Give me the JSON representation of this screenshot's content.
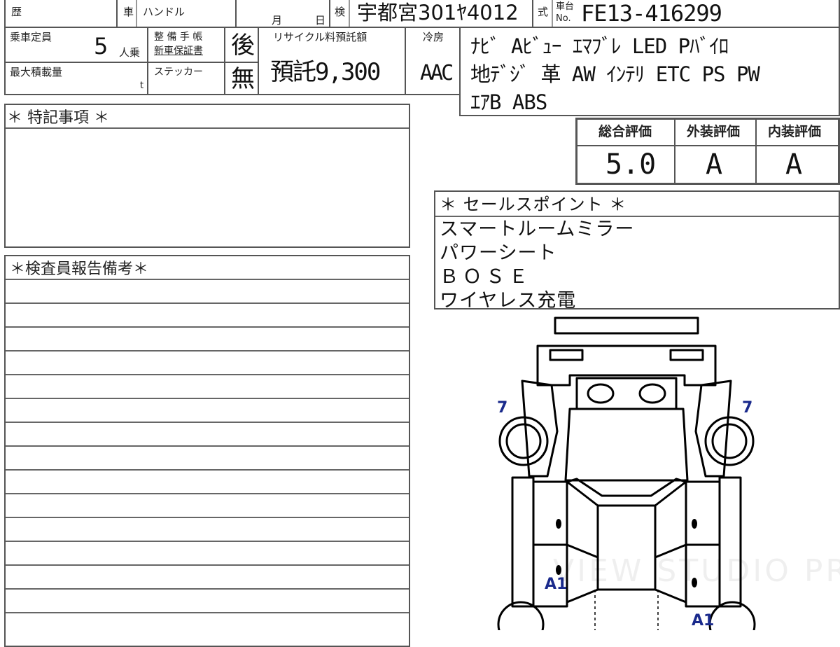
{
  "header": {
    "history_label": "歴",
    "car_label": "車",
    "handle_label": "ハンドル",
    "month_label": "月",
    "day_label": "日",
    "inspection_label": "検",
    "plate_value": "宇都宮301ﾔ4012",
    "type_label": "式",
    "chassis_label_top": "車台",
    "chassis_label_bottom": "No.",
    "chassis_value": "FE13-416299"
  },
  "details": {
    "capacity_label": "乗車定員",
    "capacity_value": "5",
    "capacity_unit": "人乗",
    "max_load_label": "最大積載量",
    "max_load_unit": "t",
    "maintenance_label_1": "整 備 手 帳",
    "maintenance_label_2": "新車保証書",
    "maintenance_value": "後",
    "sticker_label": "ステッカー",
    "sticker_value": "無",
    "recycle_label": "リサイクル料預託額",
    "recycle_value": "預託9,300",
    "ac_label": "冷房",
    "ac_value": "AAC"
  },
  "equipment": {
    "line1": "ﾅﾋﾞ Aﾋﾞｭｰ ｴﾏﾌﾞﾚ LED Pﾊﾞｲﾛ",
    "line2": "地ﾃﾞｼﾞ 革 AW ｲﾝﾃﾘ ETC PS PW",
    "line3": "ｴｱB ABS"
  },
  "ratings": {
    "overall_label": "総合評価",
    "overall_value": "5.0",
    "exterior_label": "外装評価",
    "exterior_value": "A",
    "interior_label": "内装評価",
    "interior_value": "A"
  },
  "special_notes": {
    "title": "＊ 特記事項 ＊"
  },
  "inspector_report": {
    "title": "＊検査員報告備考＊"
  },
  "sales_points": {
    "title": "＊ セールスポイント ＊",
    "items": [
      "スマートルームミラー",
      "パワーシート",
      "ＢＯＳＥ",
      "ワイヤレス充電"
    ]
  },
  "damage_map": {
    "marks": [
      "7",
      "7",
      "A1",
      "A1"
    ],
    "mark_color": "#1a2a8c"
  },
  "watermark": "VIEW STUDIO PRO"
}
